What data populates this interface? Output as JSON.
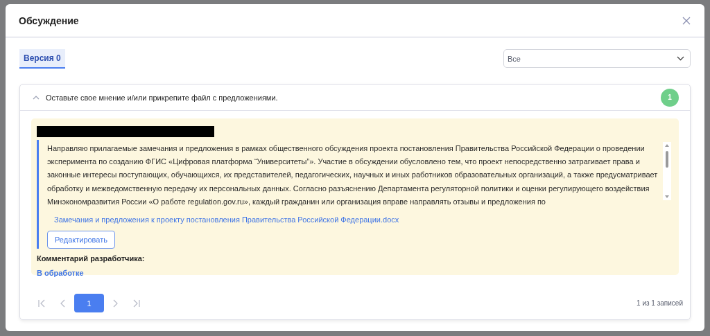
{
  "dialog": {
    "title": "Обсуждение"
  },
  "tabs": [
    {
      "label": "Версия 0",
      "selected": true
    }
  ],
  "filter": {
    "value": "Все"
  },
  "panel": {
    "title": "Оставьте свое мнение и/или прикрепите файл с предложениями.",
    "expanded": true,
    "count": "1",
    "comment": {
      "text": "Направляю прилагаемые замечания и предложения в рамках общественного обсуждения проекта постановления Правительства Российской Федерации о проведении эксперимента по созданию ФГИС «Цифровая платформа “Университеты”». Участие в обсуждении обусловлено тем, что проект непосредственно затрагивает права и законные интересы поступающих, обучающихся, их представителей, педагогических, научных и иных работников образовательных организаций, а также предусматривает обработку и межведомственную передачу их персональных данных. Согласно разъяснению Департамента регуляторной политики и оценки регулирующего воздействия Минэкономразвития России «О работе regulation.gov.ru», каждый гражданин или организация вправе направлять отзывы и предложения по",
      "attachment": "Замечания и предложения к проекту постановления Правительства Российской Федерации.docx",
      "edit_button": "Редактировать",
      "developer_label": "Комментарий разработчика:",
      "status": "В обработке"
    }
  },
  "pagination": {
    "pages": [
      {
        "label": "1",
        "selected": true
      }
    ],
    "summary": "1 из 1 записей"
  }
}
